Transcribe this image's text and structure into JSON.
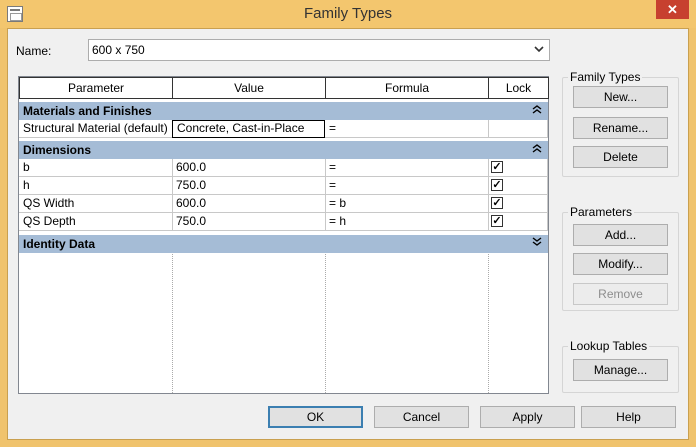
{
  "window": {
    "title": "Family Types",
    "close_glyph": "✕"
  },
  "name": {
    "label": "Name:",
    "value": "600 x 750"
  },
  "table": {
    "columns": [
      "Parameter",
      "Value",
      "Formula",
      "Lock"
    ],
    "groups": [
      {
        "label": "Materials and Finishes",
        "chevron": "⌃"
      },
      {
        "label": "Dimensions",
        "chevron": "⌃"
      },
      {
        "label": "Identity Data",
        "chevron": "⌄"
      }
    ],
    "material_row": {
      "parameter": "Structural Material (default)",
      "value": "Concrete, Cast-in-Place",
      "formula": "="
    },
    "dimension_rows": [
      {
        "parameter": "b",
        "value": "600.0",
        "formula": "=",
        "locked": true
      },
      {
        "parameter": "h",
        "value": "750.0",
        "formula": "=",
        "locked": true
      },
      {
        "parameter": "QS Width",
        "value": "600.0",
        "formula": "= b",
        "locked": true
      },
      {
        "parameter": "QS Depth",
        "value": "750.0",
        "formula": "= h",
        "locked": true
      }
    ]
  },
  "family_types": {
    "title": "Family Types",
    "new": "New...",
    "rename": "Rename...",
    "delete": "Delete"
  },
  "parameters": {
    "title": "Parameters",
    "add": "Add...",
    "modify": "Modify...",
    "remove": "Remove"
  },
  "lookup_tables": {
    "title": "Lookup Tables",
    "manage": "Manage..."
  },
  "footer": {
    "ok": "OK",
    "cancel": "Cancel",
    "apply": "Apply",
    "help": "Help"
  },
  "check_glyph": "✓",
  "icons": {
    "app": "family-types-icon",
    "dropdown": "chevron-down-icon",
    "close": "close-icon"
  }
}
